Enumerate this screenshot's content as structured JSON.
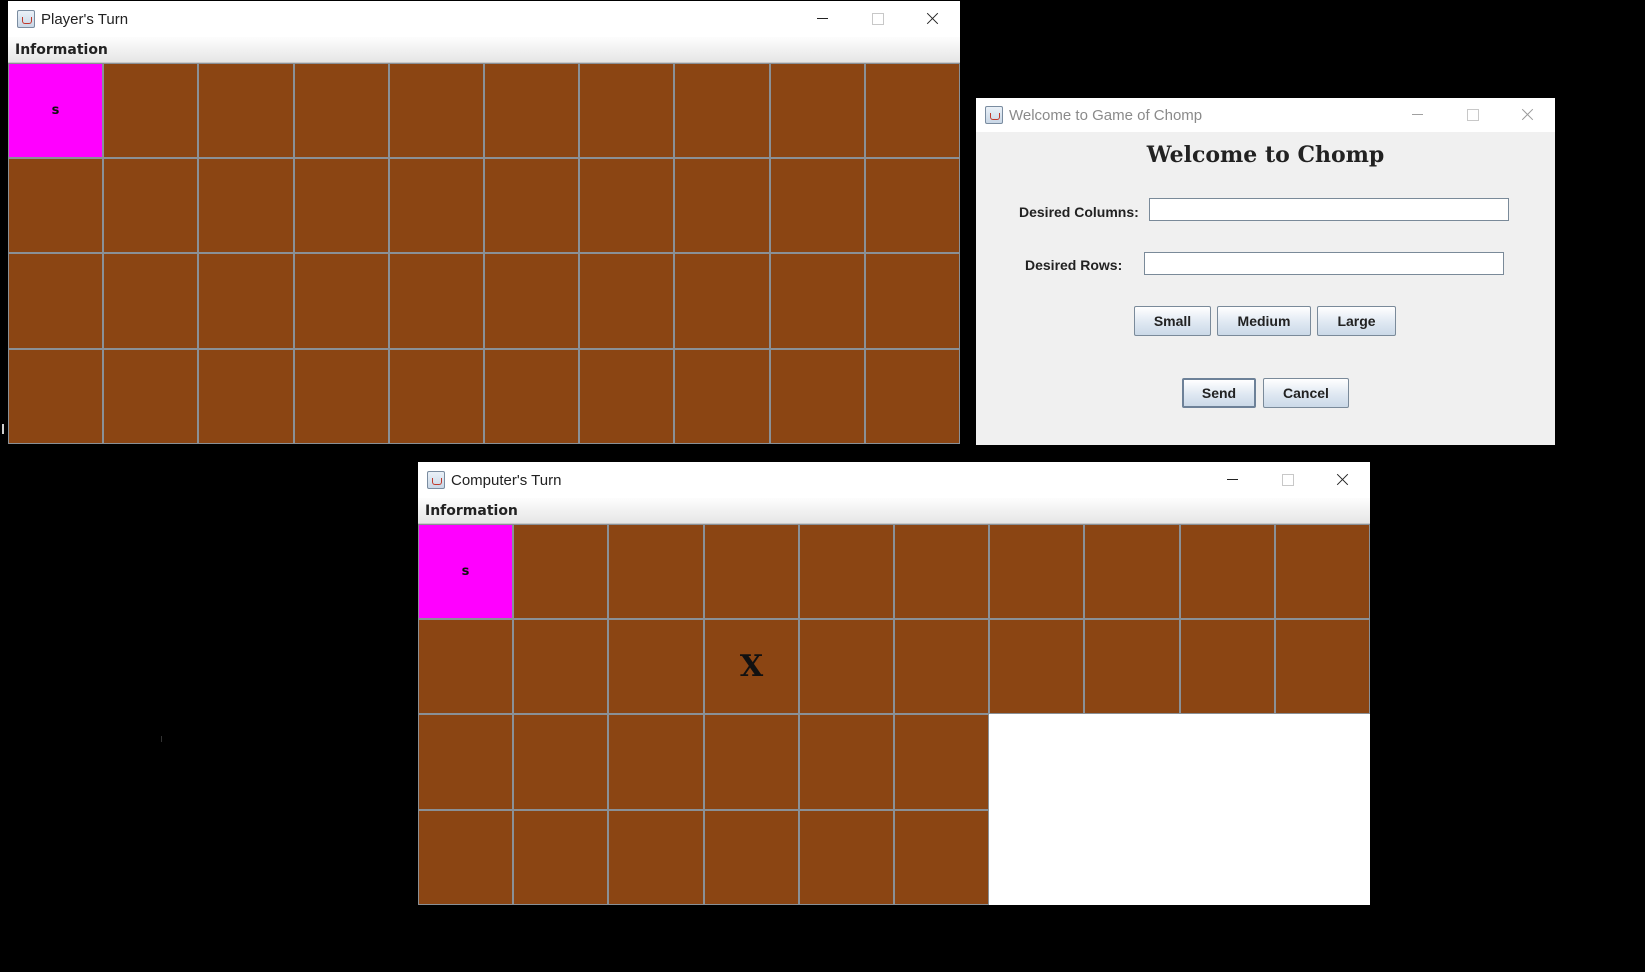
{
  "player_window": {
    "title": "Player's Turn",
    "menu": [
      "Information"
    ],
    "rows": 4,
    "cols": 10,
    "poison_label": "s",
    "eaten": [],
    "marks": []
  },
  "computer_window": {
    "title": "Computer's Turn",
    "menu": [
      "Information"
    ],
    "rows": 4,
    "cols": 10,
    "poison_label": "s",
    "eaten": [
      [
        2,
        6
      ],
      [
        2,
        7
      ],
      [
        2,
        8
      ],
      [
        2,
        9
      ],
      [
        3,
        6
      ],
      [
        3,
        7
      ],
      [
        3,
        8
      ],
      [
        3,
        9
      ]
    ],
    "marks": [
      {
        "row": 1,
        "col": 3,
        "text": "X"
      }
    ]
  },
  "welcome_dialog": {
    "window_title": "Welcome to Game of Chomp",
    "heading": "Welcome to Chomp",
    "columns_label": "Desired Columns:",
    "columns_value": "",
    "rows_label": "Desired Rows:",
    "rows_value": "",
    "size_buttons": {
      "small": "Small",
      "medium": "Medium",
      "large": "Large"
    },
    "send_label": "Send",
    "cancel_label": "Cancel"
  },
  "colors": {
    "chocolate": "#8b4513",
    "poison": "#ff00ff",
    "eaten": "#ffffff",
    "grid_line": "#8a9096",
    "desktop": "#000000"
  }
}
